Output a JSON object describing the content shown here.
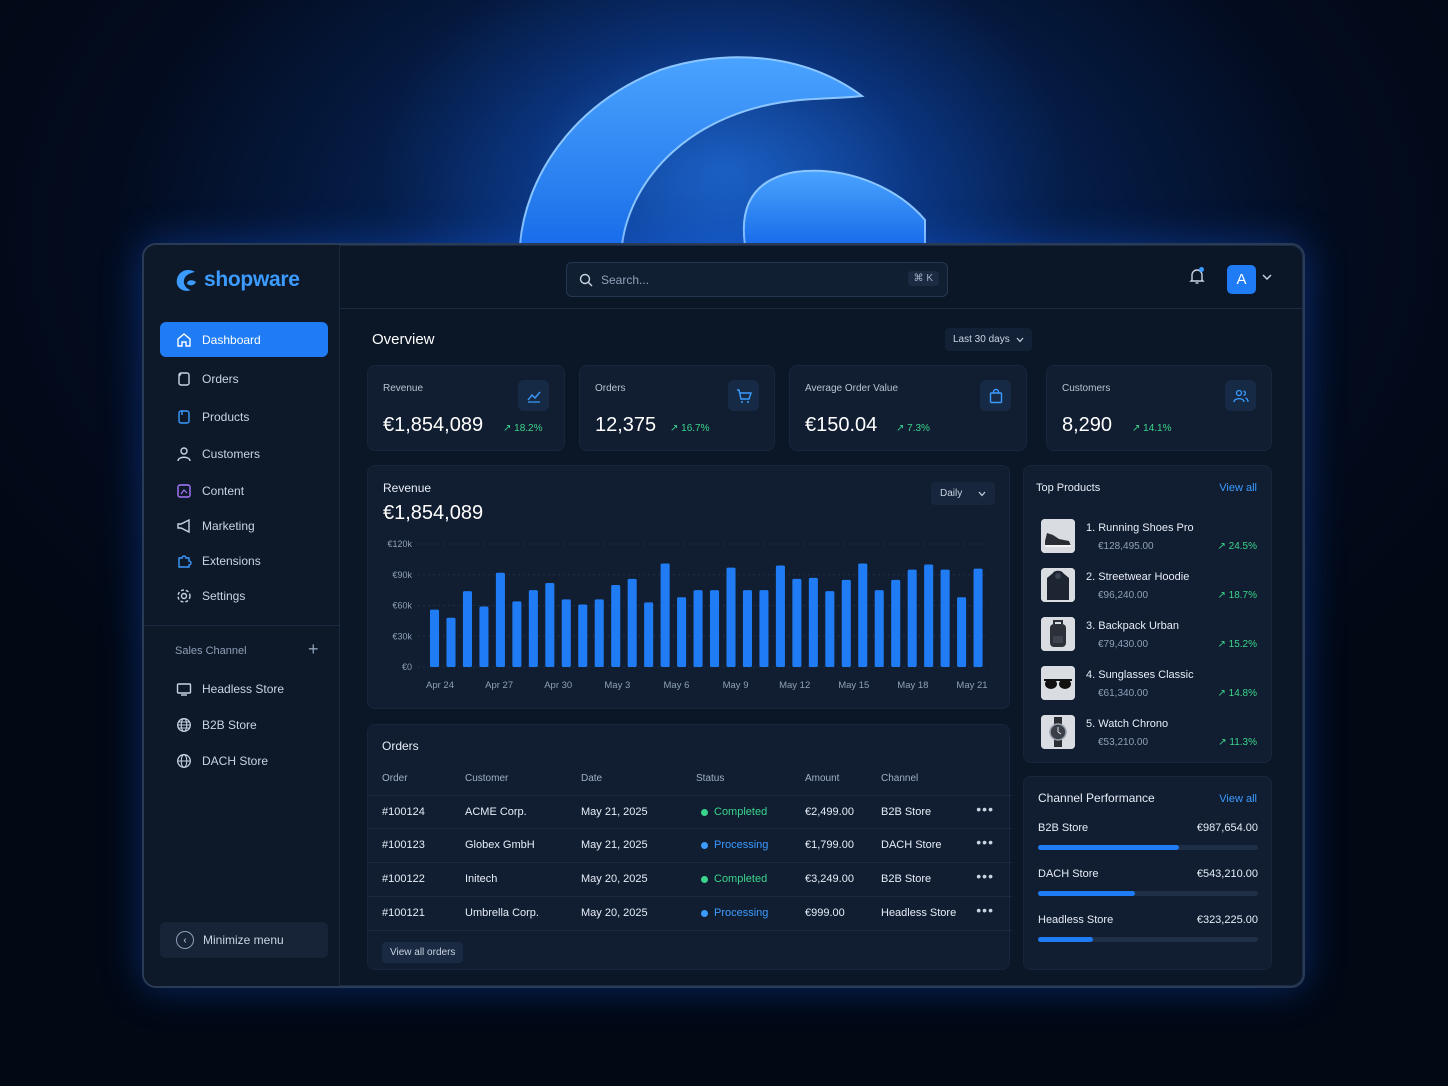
{
  "brand": {
    "name": "shopware"
  },
  "sidebar": {
    "items": [
      {
        "label": "Dashboard",
        "icon": "home-icon",
        "active": true
      },
      {
        "label": "Orders",
        "icon": "orders-icon"
      },
      {
        "label": "Products",
        "icon": "products-icon"
      },
      {
        "label": "Customers",
        "icon": "user-icon"
      },
      {
        "label": "Content",
        "icon": "content-icon"
      },
      {
        "label": "Marketing",
        "icon": "megaphone-icon"
      },
      {
        "label": "Extensions",
        "icon": "puzzle-icon"
      },
      {
        "label": "Settings",
        "icon": "gear-icon"
      }
    ],
    "sales_channel_label": "Sales Channel",
    "channels": [
      {
        "label": "Headless Store",
        "icon": "monitor-icon"
      },
      {
        "label": "B2B Store",
        "icon": "globe-icon"
      },
      {
        "label": "DACH Store",
        "icon": "globe-icon"
      }
    ],
    "minimize_label": "Minimize menu"
  },
  "topbar": {
    "search_placeholder": "Search...",
    "shortcut": "⌘ K",
    "avatar_initial": "A"
  },
  "overview": {
    "title": "Overview",
    "range": "Last 30 days"
  },
  "kpis": [
    {
      "label": "Revenue",
      "value": "€1,854,089",
      "delta": "↗ 18.2%",
      "icon": "trend-icon"
    },
    {
      "label": "Orders",
      "value": "12,375",
      "delta": "↗ 16.7%",
      "icon": "cart-icon"
    },
    {
      "label": "Average Order Value",
      "value": "€150.04",
      "delta": "↗ 7.3%",
      "icon": "bag-icon"
    },
    {
      "label": "Customers",
      "value": "8,290",
      "delta": "↗ 14.1%",
      "icon": "users-icon"
    }
  ],
  "revenue_chart": {
    "label": "Revenue",
    "value": "€1,854,089",
    "granularity": "Daily"
  },
  "chart_data": {
    "type": "bar",
    "title": "Revenue",
    "xlabel": "",
    "ylabel": "",
    "ylim": [
      0,
      120000
    ],
    "y_ticks": [
      "€0",
      "€30k",
      "€60k",
      "€90k",
      "€120k"
    ],
    "x_tick_labels": [
      "Apr 24",
      "Apr 27",
      "Apr 30",
      "May 3",
      "May 6",
      "May 9",
      "May 12",
      "May 15",
      "May 18",
      "May 21"
    ],
    "grid": true,
    "values": [
      56000,
      48000,
      74000,
      59000,
      92000,
      64000,
      75000,
      82000,
      66000,
      61000,
      66000,
      80000,
      86000,
      63000,
      101000,
      68000,
      75000,
      75000,
      97000,
      75000,
      75000,
      99000,
      86000,
      87000,
      74000,
      85000,
      101000,
      75000,
      85000,
      95000,
      100000,
      95000,
      68000,
      96000
    ],
    "color": "#1f7cf5"
  },
  "top_products": {
    "title": "Top Products",
    "view_all": "View all",
    "items": [
      {
        "name": "1. Running Shoes Pro",
        "price": "€128,495.00",
        "delta": "↗ 24.5%",
        "icon": "shoe-icon"
      },
      {
        "name": "2. Streetwear Hoodie",
        "price": "€96,240.00",
        "delta": "↗ 18.7%",
        "icon": "hoodie-icon"
      },
      {
        "name": "3. Backpack Urban",
        "price": "€79,430.00",
        "delta": "↗ 15.2%",
        "icon": "backpack-icon"
      },
      {
        "name": "4. Sunglasses Classic",
        "price": "€61,340.00",
        "delta": "↗ 14.8%",
        "icon": "sunglasses-icon"
      },
      {
        "name": "5. Watch Chrono",
        "price": "€53,210.00",
        "delta": "↗ 11.3%",
        "icon": "watch-icon"
      }
    ]
  },
  "channel_performance": {
    "title": "Channel Performance",
    "view_all": "View all",
    "rows": [
      {
        "name": "B2B Store",
        "value": "€987,654.00",
        "share": 0.64
      },
      {
        "name": "DACH Store",
        "value": "€543,210.00",
        "share": 0.44
      },
      {
        "name": "Headless Store",
        "value": "€323,225.00",
        "share": 0.25
      }
    ]
  },
  "orders": {
    "title": "Orders",
    "columns": [
      "Order",
      "Customer",
      "Date",
      "Status",
      "Amount",
      "Channel"
    ],
    "rows": [
      {
        "order": "#100124",
        "customer": "ACME Corp.",
        "date": "May 21, 2025",
        "status": "Completed",
        "status_color": "#3bd48b",
        "amount": "€2,499.00",
        "channel": "B2B Store"
      },
      {
        "order": "#100123",
        "customer": "Globex GmbH",
        "date": "May 21, 2025",
        "status": "Processing",
        "status_color": "#3b9bff",
        "amount": "€1,799.00",
        "channel": "DACH Store"
      },
      {
        "order": "#100122",
        "customer": "Initech",
        "date": "May 20, 2025",
        "status": "Completed",
        "status_color": "#3bd48b",
        "amount": "€3,249.00",
        "channel": "B2B Store"
      },
      {
        "order": "#100121",
        "customer": "Umbrella Corp.",
        "date": "May 20, 2025",
        "status": "Processing",
        "status_color": "#3b9bff",
        "amount": "€999.00",
        "channel": "Headless Store"
      }
    ],
    "view_all": "View all orders"
  }
}
